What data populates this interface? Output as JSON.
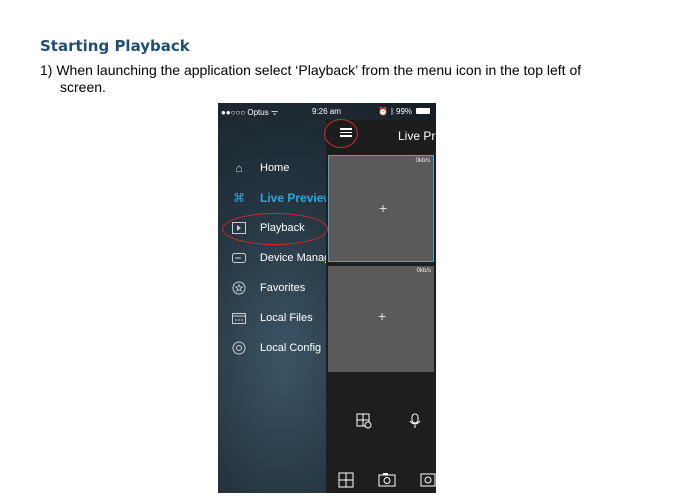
{
  "document": {
    "heading": "Starting Playback",
    "step_line1": "1) When launching the application select ‘Playback’ from the menu icon in the top left of",
    "step_line2": "screen."
  },
  "phone": {
    "status_bar": {
      "carrier": "●●○○○ Optus ᯤ",
      "time": "9:26 am",
      "battery": "99%"
    },
    "menu": [
      {
        "label": "Home",
        "icon": "home-icon"
      },
      {
        "label": "Live Preview",
        "icon": "camera-icon",
        "active": true
      },
      {
        "label": "Playback",
        "icon": "playback-icon"
      },
      {
        "label": "Device Manager",
        "icon": "device-icon"
      },
      {
        "label": "Favorites",
        "icon": "star-icon"
      },
      {
        "label": "Local Files",
        "icon": "files-icon"
      },
      {
        "label": "Local Config",
        "icon": "config-icon"
      }
    ],
    "live": {
      "title": "Live Preview",
      "slot1_rate": "0kb/s",
      "slot2_rate": "0kb/s",
      "plus": "+"
    },
    "colors": {
      "highlight": "#d6262c",
      "active_menu": "#2ea6e0",
      "selected_slot_border": "#4aa6d8"
    }
  }
}
